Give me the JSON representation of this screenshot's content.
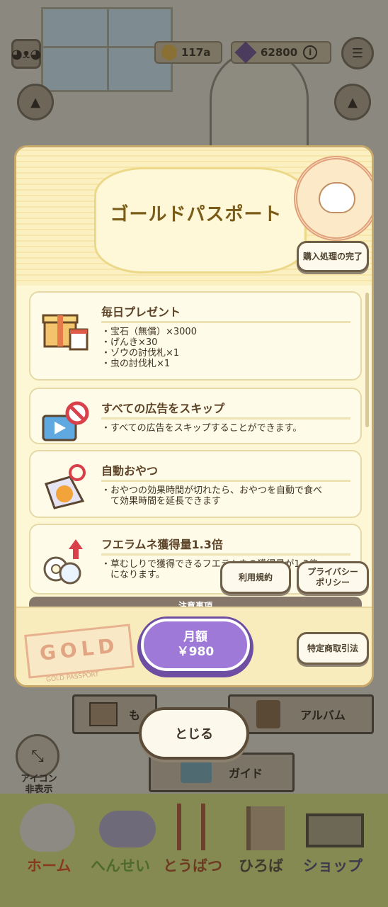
{
  "header": {
    "coins": "117a",
    "gems": "62800"
  },
  "modal": {
    "title": "ゴールドパスポート",
    "restore_label": "購入処理の完了",
    "items": [
      {
        "title": "毎日プレゼント",
        "body": "・宝石（無償）×3000\n・げんき×30\n・ゾウの討伐札×1\n・虫の討伐札×1"
      },
      {
        "title": "すべての広告をスキップ",
        "body": "・すべての広告をスキップすることができます。"
      },
      {
        "title": "自動おやつ",
        "body": "・おやつの効果時間が切れたら、おやつを自動で食べ\n　て効果時間を延長できます"
      },
      {
        "title": "フエラムネ獲得量1.3倍",
        "body": "・草むしりで獲得できるフエラムネの獲得量が1.3倍\n　になります。"
      }
    ],
    "terms_label": "利用規約",
    "privacy_label": "プライバシー\nポリシー",
    "notice_label": "注意事項",
    "gold_stamp": "GOLD",
    "gold_stamp_sub": "GOLD PASSPORT",
    "price_line1": "月額",
    "price_line2": "￥980",
    "commerce_label": "特定商取引法"
  },
  "close_label": "とじる",
  "background_menu": {
    "mail_label": "も",
    "album_label": "アルバム",
    "guide_label": "ガイド"
  },
  "hide_icon_label": "アイコン\n非表示",
  "nav": [
    {
      "label": "ホーム"
    },
    {
      "label": "へんせい"
    },
    {
      "label": "とうばつ"
    },
    {
      "label": "ひろば"
    },
    {
      "label": "ショップ"
    }
  ],
  "colors": {
    "accent_purple": "#9f79d8",
    "modal_bg": "#fdf7d6",
    "title_gold": "#7a5c18"
  }
}
